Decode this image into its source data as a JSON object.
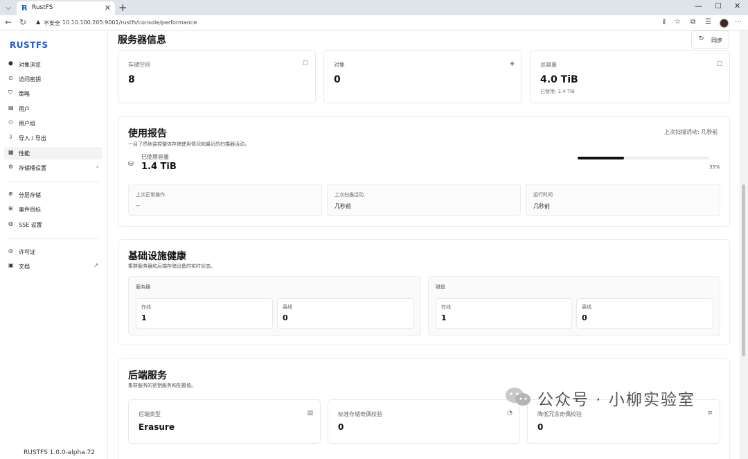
{
  "browser": {
    "tab_title": "RustFS",
    "tab_favicon": "R",
    "security_label": "不安全",
    "url": "10.10.100.205:9001/rustfs/console/performance"
  },
  "sidebar": {
    "logo": "RUSTFS",
    "items": [
      {
        "label": "对象浏览",
        "icon": "cube-icon"
      },
      {
        "label": "访问密钥",
        "icon": "key-icon"
      },
      {
        "label": "策略",
        "icon": "shield-icon"
      },
      {
        "label": "用户",
        "icon": "user-icon"
      },
      {
        "label": "用户组",
        "icon": "users-icon"
      },
      {
        "label": "导入 / 导出",
        "icon": "download-icon"
      },
      {
        "label": "性能",
        "icon": "chart-icon"
      },
      {
        "label": "存储桶设置",
        "icon": "settings-icon"
      },
      {
        "label": "分层存储",
        "icon": "layers-icon"
      },
      {
        "label": "事件目标",
        "icon": "target-icon"
      },
      {
        "label": "SSE 设置",
        "icon": "lock-icon"
      },
      {
        "label": "许可证",
        "icon": "license-icon"
      },
      {
        "label": "文档",
        "icon": "doc-icon"
      }
    ],
    "version": "RUSTFS 1.0.0-alpha.72"
  },
  "server_info": {
    "title": "服务器信息",
    "sync_label": "同步",
    "cards": [
      {
        "label": "存储空间",
        "value": "8",
        "icon": "bucket-icon"
      },
      {
        "label": "对象",
        "value": "0",
        "icon": "layers-icon"
      },
      {
        "label": "总容量",
        "value": "4.0 TiB",
        "note": "已使用: 1.4 TiB",
        "icon": "disk-icon"
      }
    ]
  },
  "usage": {
    "title": "使用报告",
    "subtitle": "一目了然地监控整体存储使用情况和最近的扫描器活动。",
    "last_scan_label": "上次扫描活动: 几秒前",
    "used_label": "已使用容量",
    "used_value": "1.4 TiB",
    "percent_text": "35%",
    "percent": 0.35,
    "stats": [
      {
        "label": "上次正常操作",
        "value": "--"
      },
      {
        "label": "上次扫描活动",
        "value": "几秒前"
      },
      {
        "label": "运行时间",
        "value": "几秒前"
      }
    ]
  },
  "health": {
    "title": "基础设施健康",
    "subtitle": "集群服务器和后端存储设备的实时状态。",
    "groups": [
      {
        "label": "服务器",
        "online_label": "在线",
        "online": "1",
        "offline_label": "离线",
        "offline": "0"
      },
      {
        "label": "磁盘",
        "online_label": "在线",
        "online": "1",
        "offline_label": "离线",
        "offline": "0"
      }
    ]
  },
  "backend": {
    "title": "后端服务",
    "subtitle": "集群服务的密钥服务和配置值。",
    "cards": [
      {
        "label": "后端类型",
        "value": "Erasure",
        "icon": "server-icon"
      },
      {
        "label": "标准存储奇偶校验",
        "value": "0",
        "icon": "pie-icon"
      },
      {
        "label": "降低冗余奇偶校验",
        "value": "0",
        "icon": "list-icon"
      }
    ]
  },
  "watermark": {
    "text": "公众号 · 小柳实验室"
  }
}
